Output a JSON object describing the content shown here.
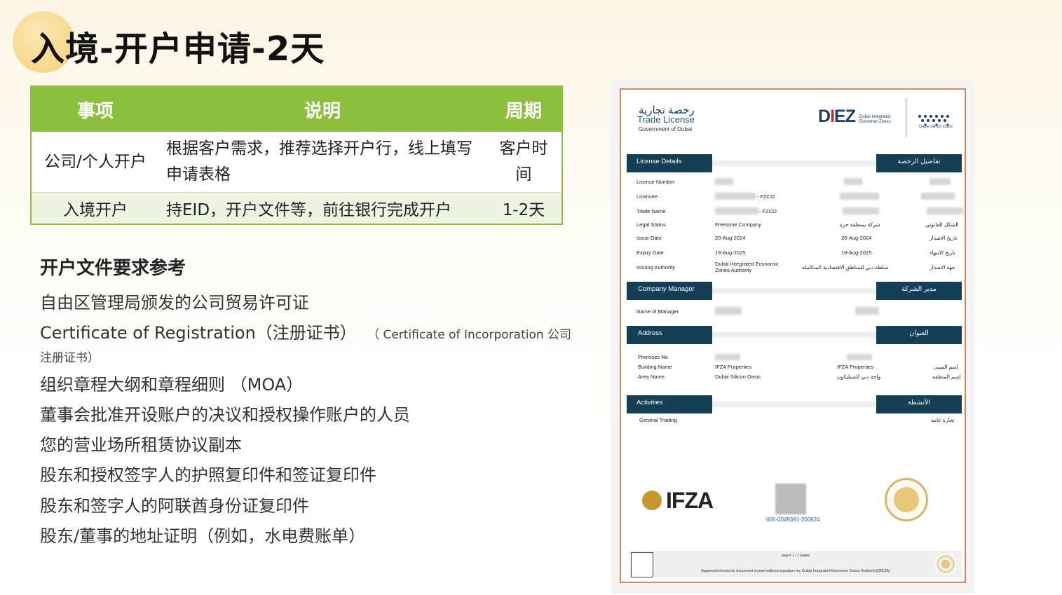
{
  "title": "入境-开户申请-2天",
  "table": {
    "headers": [
      "事项",
      "说明",
      "周期"
    ],
    "rows": [
      {
        "item": "公司/个人开户",
        "desc": "根据客户需求，推荐选择开户行，线上填写申请表格",
        "period": "客户时间"
      },
      {
        "item": "入境开户",
        "desc": "持EID，开户文件等，前往银行完成开户",
        "period": "1-2天"
      }
    ]
  },
  "requirements": {
    "heading": "开户文件要求参考",
    "items": [
      "自由区管理局颁发的公司贸易许可证",
      "Certificate of Registration（注册证书）",
      "组织章程大纲和章程细则 （MOA）",
      "董事会批准开设账户的决议和授权操作账户的人员",
      "您的营业场所租赁协议副本",
      "股东和授权签字人的护照复印件和签证复印件",
      "股东和签字人的阿联酋身份证复印件",
      "股东/董事的地址证明（例如，水电费账单）"
    ],
    "note_part1": "（ Certificate of Incorporation 公司",
    "note_part2": "注册证书）"
  },
  "license": {
    "ar_title": "رخصة تجارية",
    "title": "Trade License",
    "gov": "Government of Dubai",
    "diez_text": "DIEZ",
    "diez_sub": "Dubai Integrated Economic Zones",
    "dso": "Dubai Silicon Oasis",
    "sections": {
      "details": "License Details",
      "details_ar": "تفاصيل الرخصة",
      "manager": "Company Manager",
      "manager_ar": "مدير الشركة",
      "address": "Address",
      "address_ar": "العنوان",
      "activities": "Activities",
      "activities_ar": "الأنشطة"
    },
    "fields": {
      "license_number": "License Number",
      "licensee": "Licensee",
      "trade_name": "Trade Name",
      "legal_status": "Legal Status",
      "issue_date": "Issue Date",
      "expiry_date": "Expiry Date",
      "issuing_authority": "Issuing Authority",
      "name_of_manager": "Name of Manager",
      "premises_no": "Premises No",
      "building_name": "Building Name",
      "area_name": "Area Name"
    },
    "values": {
      "licensee_suffix": "- FZCO",
      "trade_suffix": "- FZCO",
      "legal_status": "Freezone Company",
      "legal_status_ar": "شركة بمنطقة حرة",
      "issue_date": "20-Aug-2024",
      "expiry_date": "19-Aug-2025",
      "authority": "Dubai Integrated Economic Zones Authority",
      "authority_ar": "سلطة دبي للمناطق الاقتصادية المتكاملة",
      "building": "IFZA Properties",
      "area": "Dubai Silicon Oasis",
      "area_ar": "واحة دبي للسيليكون",
      "activity": "General Trading",
      "activity_ar": "تجارة عامة"
    },
    "labels_ar": {
      "legal_status": "الشكل القانوني",
      "issue_date": "تاريخ الاصدار",
      "expiry_date": "تاريخ الانتهاء",
      "authority": "جهة الاصدار",
      "building": "إسم المبنى",
      "area": "إسم المنطقة"
    },
    "ifza": "IFZA",
    "qr_number": "006-0049391-200824",
    "footer_page": "page# 1 / 1 pages",
    "footer_text": "Approved electronic document issued without signature by Dubai Integrated Economic Zones Authority(DIEZA)"
  }
}
